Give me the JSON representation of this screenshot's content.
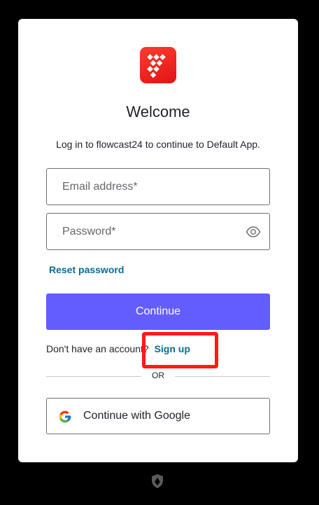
{
  "logo": {
    "icon": "tidal-logo-icon",
    "color": "#ff2d20"
  },
  "title": "Welcome",
  "subtitle": "Log in to flowcast24 to continue to Default App.",
  "email": {
    "placeholder": "Email address*",
    "value": ""
  },
  "password": {
    "placeholder": "Password*",
    "value": "",
    "toggle_icon": "eye-icon"
  },
  "reset_link": "Reset password",
  "continue_label": "Continue",
  "signup": {
    "prompt": "Don't have an account?",
    "link": "Sign up"
  },
  "divider_label": "OR",
  "google": {
    "label": "Continue with Google",
    "icon": "google-icon"
  },
  "footer": {
    "icon": "shield-icon"
  },
  "colors": {
    "primary": "#635dff",
    "link": "#0a6c94",
    "highlight": "#ff1a1a",
    "background": "#000000"
  }
}
